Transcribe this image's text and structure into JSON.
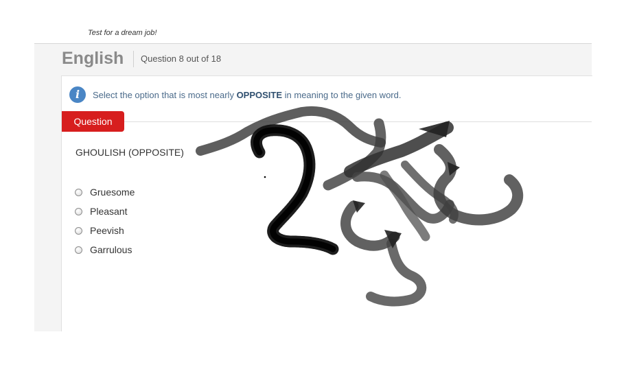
{
  "header": {
    "tagline": "Test for a dream job!",
    "section_title": "English",
    "progress": "Question 8 out of 18"
  },
  "instruction": {
    "icon": "info-icon",
    "text_before": "Select the option that is most nearly ",
    "emphasis": "OPPOSITE",
    "text_after": " in meaning to the given word."
  },
  "question": {
    "tab_label": "Question",
    "text": "GHOULISH (OPPOSITE)",
    "options": [
      {
        "label": "Gruesome",
        "selected": false
      },
      {
        "label": "Pleasant",
        "selected": false
      },
      {
        "label": "Peevish",
        "selected": false
      },
      {
        "label": "Garrulous",
        "selected": false
      }
    ]
  },
  "colors": {
    "accent_red": "#d71e1e",
    "info_blue": "#4a86c5",
    "title_gray": "#8a8a8a"
  }
}
